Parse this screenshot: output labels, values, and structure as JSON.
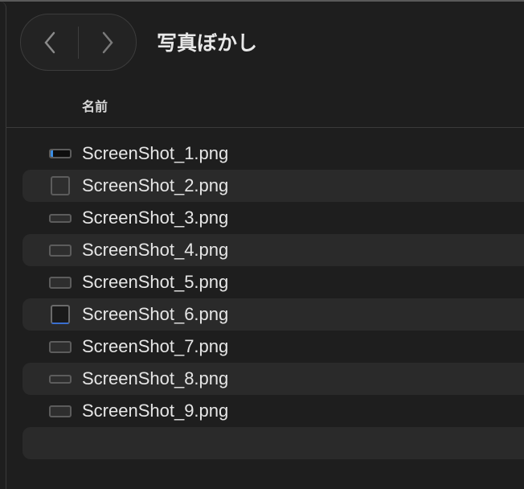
{
  "header": {
    "title": "写真ぼかし",
    "back_label": "back",
    "forward_label": "forward"
  },
  "columns": {
    "name": "名前"
  },
  "files": [
    {
      "name": "ScreenShot_1.png",
      "icon": "wide-dark-thumbnail-icon"
    },
    {
      "name": "ScreenShot_2.png",
      "icon": "square-thumbnail-icon"
    },
    {
      "name": "ScreenShot_3.png",
      "icon": "wide-thumbnail-icon"
    },
    {
      "name": "ScreenShot_4.png",
      "icon": "wide-thumbnail-icon"
    },
    {
      "name": "ScreenShot_5.png",
      "icon": "wide-thumbnail-icon"
    },
    {
      "name": "ScreenShot_6.png",
      "icon": "square-thumbnail-icon"
    },
    {
      "name": "ScreenShot_7.png",
      "icon": "wide-thumbnail-icon"
    },
    {
      "name": "ScreenShot_8.png",
      "icon": "wide-thumbnail-icon"
    },
    {
      "name": "ScreenShot_9.png",
      "icon": "wide-thumbnail-icon"
    }
  ]
}
